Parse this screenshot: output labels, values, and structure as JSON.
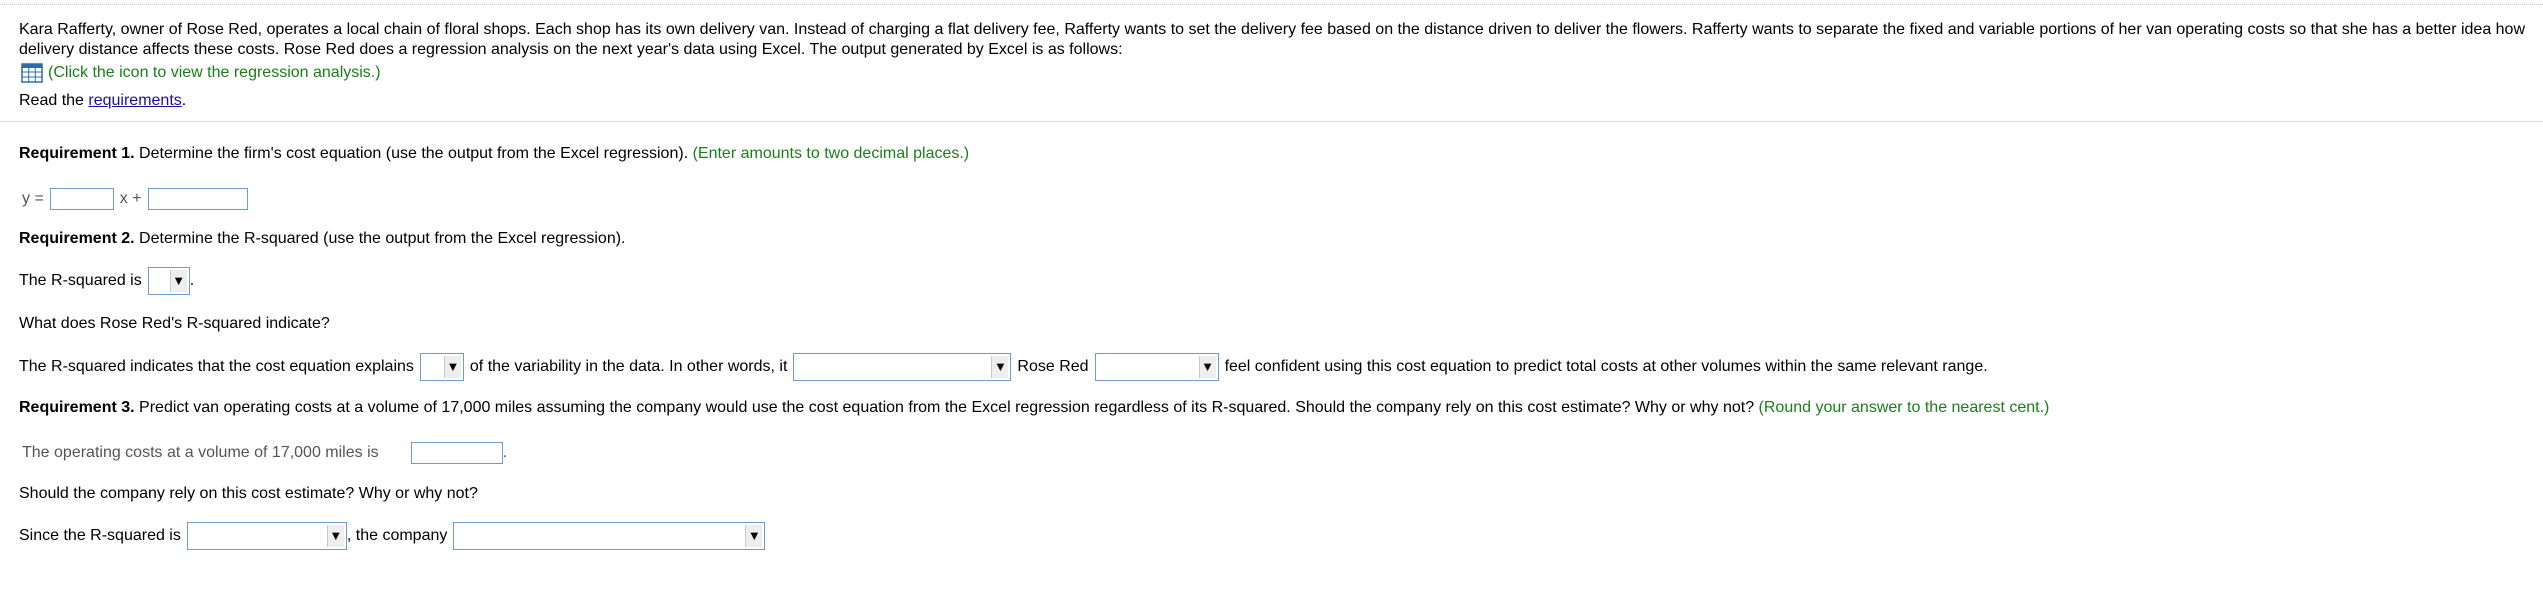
{
  "intro": {
    "paragraph": "Kara Rafferty, owner of Rose Red, operates a local chain of floral shops. Each shop has its own delivery van. Instead of charging a flat delivery fee, Rafferty wants to set the delivery fee based on the distance driven to deliver the flowers. Rafferty wants to separate the fixed and variable portions of her van operating costs so that she has a better idea how delivery distance affects these costs. Rose Red does a regression analysis on the next year's data using Excel. The output generated by Excel is as follows:",
    "icon_hint": "(Click the icon to view the regression analysis.)",
    "icon_name": "table-grid-icon",
    "read_prefix": "Read the ",
    "read_link": "requirements",
    "read_suffix": "."
  },
  "req1": {
    "heading": "Requirement 1.",
    "text": " Determine the firm's cost equation (use the output from the Excel regression).",
    "hint": " (Enter amounts to two decimal places.)",
    "y_label": "y =",
    "x_label": "x +",
    "slope_value": "",
    "intercept_value": ""
  },
  "req2": {
    "heading": "Requirement 2.",
    "text": " Determine the R-squared (use the output from the Excel regression).",
    "rsq_prefix": "The R-squared is",
    "rsq_suffix": ".",
    "rsq_selected": "",
    "question": "What does Rose Red's R-squared indicate?",
    "indicates_prefix": "The R-squared indicates that the cost equation explains",
    "indicates_middle": "of the variability in the data. In other words, it",
    "rose_red": "Rose Red",
    "indicates_suffix": "feel confident using this cost equation to predict total costs at other volumes within the same relevant range.",
    "variability_selected": "",
    "it_selected": "",
    "rose_red_selected": ""
  },
  "req3": {
    "heading": "Requirement 3.",
    "text": " Predict van operating costs at a volume of 17,000 miles assuming the company would use the cost equation from the Excel regression regardless of its R-squared. Should the company rely on this cost estimate? Why or why not?",
    "hint": " (Round your answer to the nearest cent.)",
    "cost_prefix": "The operating costs at a volume of 17,000 miles is",
    "cost_suffix": ".",
    "cost_value": "",
    "question": "Should the company rely on this cost estimate? Why or why not?",
    "since_prefix": "Since the R-squared is",
    "since_middle": ", the company",
    "since_selected": "",
    "company_selected": ""
  },
  "colors": {
    "hint_green": "#1a7f1a",
    "link_blue": "#1a0dab",
    "field_border": "#6f9bd1",
    "icon_blue": "#2a6db5"
  }
}
